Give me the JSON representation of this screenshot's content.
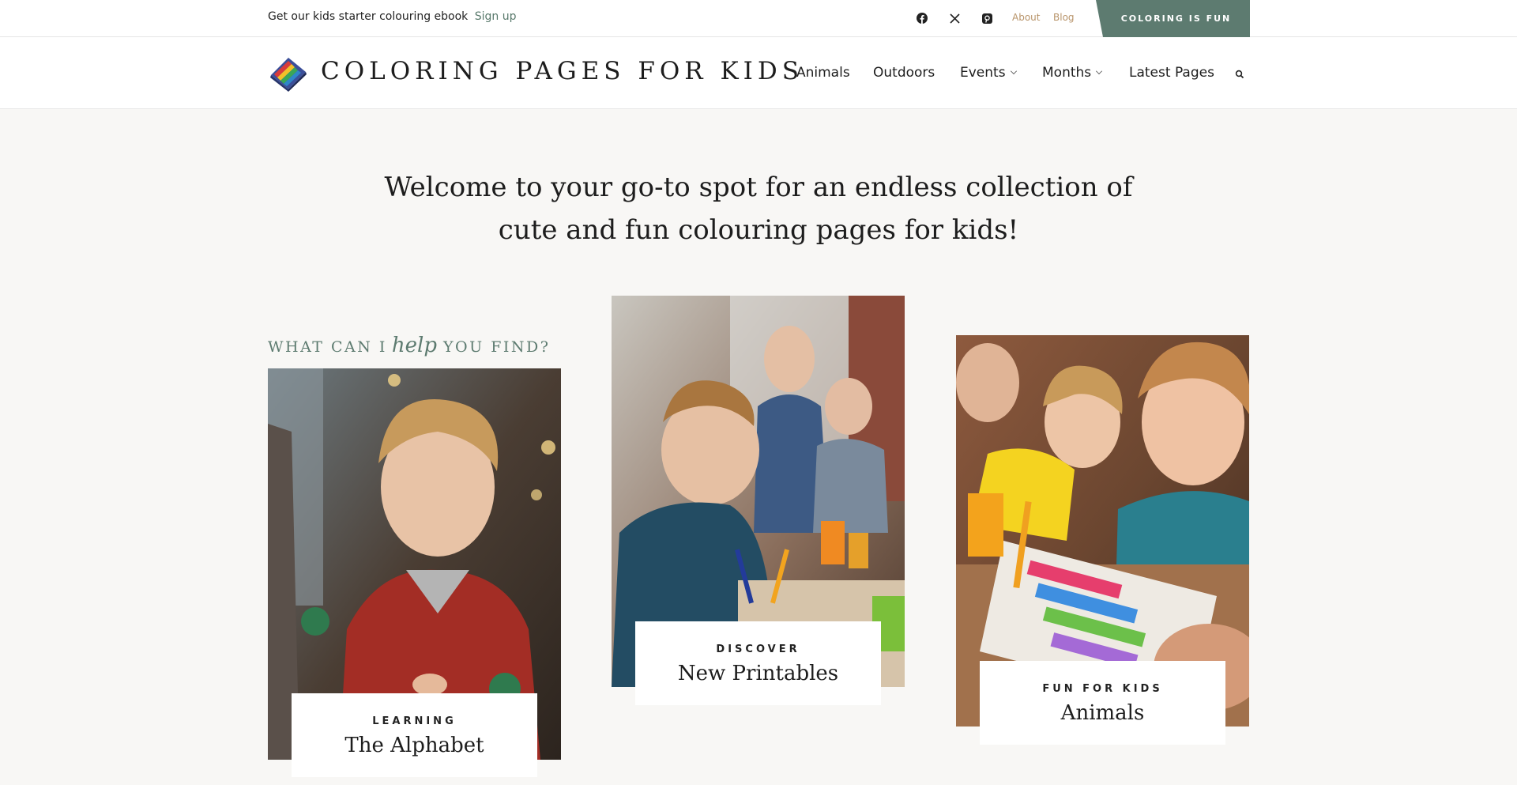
{
  "topbar": {
    "promo_text": "Get our kids starter colouring ebook",
    "signup_label": "Sign up",
    "social": [
      "facebook-icon",
      "x-icon",
      "pinterest-icon"
    ],
    "about_label": "About",
    "blog_label": "Blog",
    "cta_label": "COLORING IS FUN"
  },
  "header": {
    "logo_text": "COLORING PAGES FOR KIDS",
    "nav": {
      "animals": "Animals",
      "outdoors": "Outdoors",
      "events": "Events",
      "months": "Months",
      "latest": "Latest Pages"
    }
  },
  "hero": {
    "line1": "Welcome to your go-to spot for an endless collection of",
    "line2": "cute and fun colouring pages for kids!"
  },
  "kicker": {
    "before": "WHAT CAN I",
    "script": "help",
    "after": "YOU FIND?"
  },
  "cards": [
    {
      "category": "LEARNING",
      "title": "The Alphabet"
    },
    {
      "category": "DISCOVER",
      "title": "New Printables"
    },
    {
      "category": "FUN FOR KIDS",
      "title": "Animals"
    }
  ],
  "colors": {
    "accent": "#5d7b70",
    "link_gold": "#b8946a",
    "background": "#f8f7f5"
  }
}
